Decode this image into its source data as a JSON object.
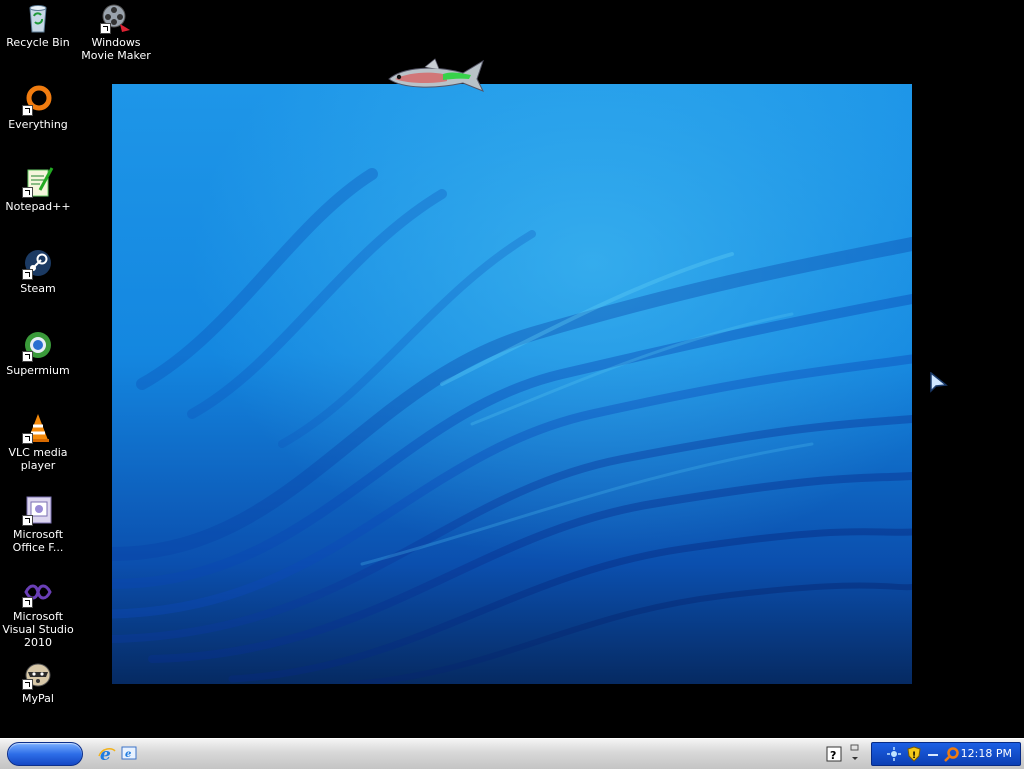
{
  "desktop": {
    "icons": [
      {
        "label": "Recycle Bin",
        "icon": "recycle-bin-icon"
      },
      {
        "label": "Windows Movie Maker",
        "icon": "movie-maker-icon"
      },
      {
        "label": "Everything",
        "icon": "everything-icon"
      },
      {
        "label": "Notepad++",
        "icon": "notepadpp-icon"
      },
      {
        "label": "Steam",
        "icon": "steam-icon"
      },
      {
        "label": "Supermium",
        "icon": "supermium-icon"
      },
      {
        "label": "VLC media player",
        "icon": "vlc-icon"
      },
      {
        "label": "Microsoft Office F...",
        "icon": "office-icon"
      },
      {
        "label": "Microsoft Visual Studio 2010",
        "icon": "visual-studio-icon"
      },
      {
        "label": "MyPal",
        "icon": "mypal-icon"
      }
    ]
  },
  "taskbar": {
    "quick_launch": [
      "internet-explorer-icon",
      "show-desktop-icon"
    ],
    "tray_icons": [
      "network-icon",
      "security-shield-icon",
      "volume-icon",
      "search-icon"
    ],
    "clock": "12:18 PM"
  },
  "colors": {
    "desktop_bg": "#000000",
    "wallpaper_blue": "#1b8fe3",
    "taskbar_gray": "#d8d8d8",
    "tray_blue": "#1c5fe3"
  }
}
